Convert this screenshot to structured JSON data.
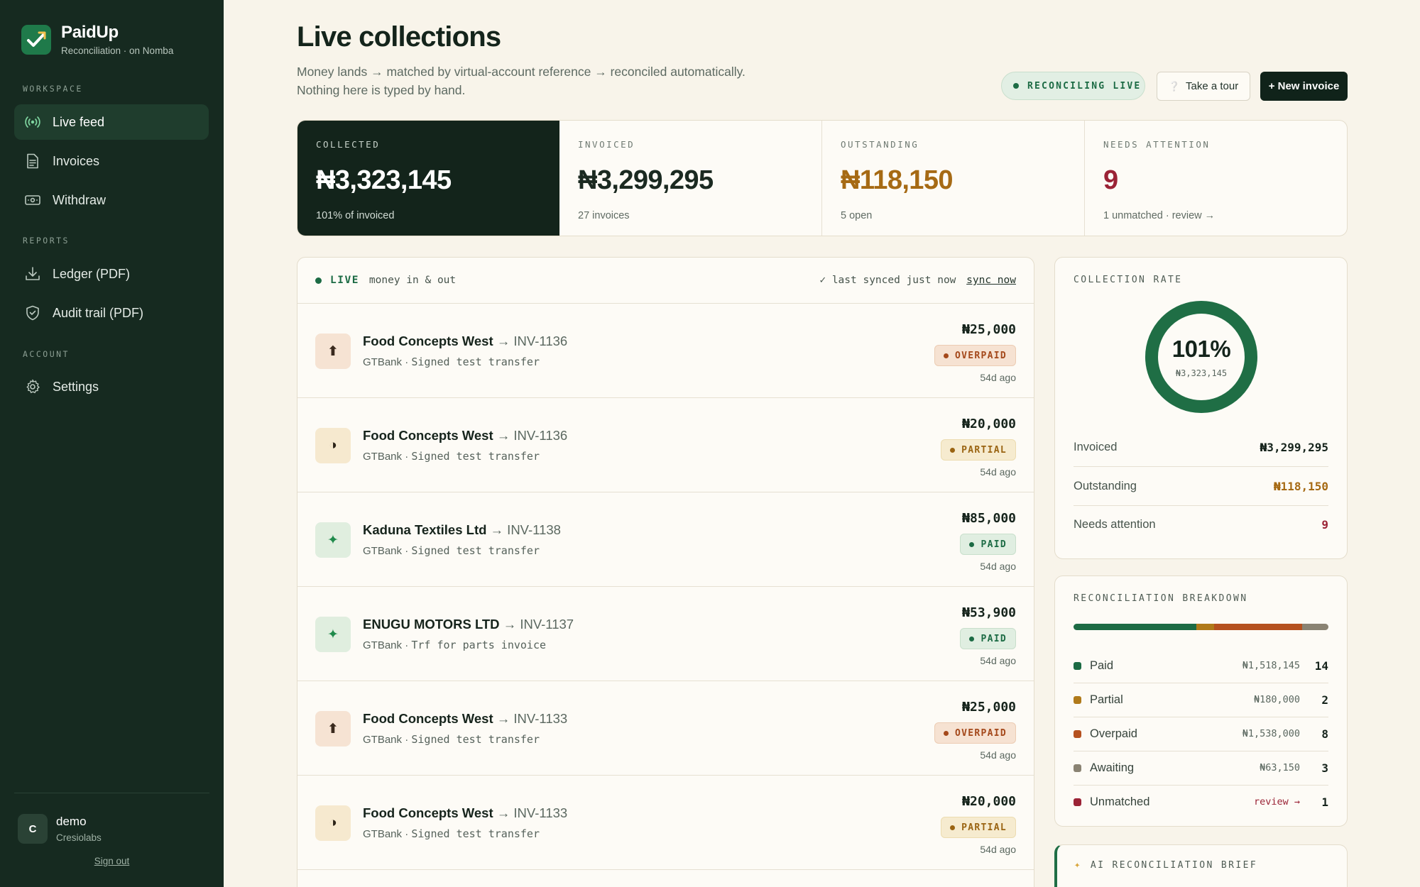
{
  "brand": {
    "name": "PaidUp",
    "subtitle": "Reconciliation · on Nomba"
  },
  "sidebar": {
    "sections": {
      "workspace": "WORKSPACE",
      "reports": "REPORTS",
      "account": "ACCOUNT"
    },
    "items": [
      {
        "label": "Live feed",
        "icon": "broadcast-icon",
        "active": true
      },
      {
        "label": "Invoices",
        "icon": "document-icon"
      },
      {
        "label": "Withdraw",
        "icon": "cash-icon"
      },
      {
        "label": "Ledger (PDF)",
        "icon": "download-icon"
      },
      {
        "label": "Audit trail (PDF)",
        "icon": "shield-icon"
      },
      {
        "label": "Settings",
        "icon": "gear-icon"
      }
    ],
    "user": {
      "initial": "C",
      "name": "demo",
      "org": "Cresiolabs"
    },
    "signout": "Sign out"
  },
  "header": {
    "title": "Live collections",
    "subtitle_line1": "Money lands → matched by virtual-account reference → reconciled automatically.",
    "subtitle_line2": "Nothing here is typed by hand.",
    "status_pill": "RECONCILING LIVE",
    "tour_button": "Take a tour",
    "new_button": "+ New invoice"
  },
  "stats": [
    {
      "label": "COLLECTED",
      "value": "₦3,323,145",
      "note": "101% of invoiced"
    },
    {
      "label": "INVOICED",
      "value": "₦3,299,295",
      "note": "27 invoices"
    },
    {
      "label": "OUTSTANDING",
      "value": "₦118,150",
      "note": "5 open"
    },
    {
      "label": "NEEDS ATTENTION",
      "value": "9",
      "note": "1 unmatched · review →"
    }
  ],
  "feed": {
    "live_label": "LIVE",
    "title": "money in & out",
    "sync_text": "✓ last synced just now",
    "sync_link": "sync now",
    "rows": [
      {
        "customer": "Food Concepts West",
        "invoice": " → INV-1136",
        "bank": "GTBank",
        "memo": "Signed test transfer",
        "amount": "₦25,000",
        "status": "OVERPAID",
        "time": "54d ago",
        "glyph": "⬆"
      },
      {
        "customer": "Food Concepts West",
        "invoice": " → INV-1136",
        "bank": "GTBank",
        "memo": "Signed test transfer",
        "amount": "₦20,000",
        "status": "PARTIAL",
        "time": "54d ago",
        "glyph": "◑"
      },
      {
        "customer": "Kaduna Textiles Ltd",
        "invoice": " → INV-1138",
        "bank": "GTBank",
        "memo": "Signed test transfer",
        "amount": "₦85,000",
        "status": "PAID",
        "time": "54d ago",
        "glyph": "✦"
      },
      {
        "customer": "ENUGU MOTORS LTD",
        "invoice": " → INV-1137",
        "bank": "GTBank",
        "memo": "Trf for parts invoice",
        "amount": "₦53,900",
        "status": "PAID",
        "time": "54d ago",
        "glyph": "✦"
      },
      {
        "customer": "Food Concepts West",
        "invoice": " → INV-1133",
        "bank": "GTBank",
        "memo": "Signed test transfer",
        "amount": "₦25,000",
        "status": "OVERPAID",
        "time": "54d ago",
        "glyph": "⬆"
      },
      {
        "customer": "Food Concepts West",
        "invoice": " → INV-1133",
        "bank": "GTBank",
        "memo": "Signed test transfer",
        "amount": "₦20,000",
        "status": "PARTIAL",
        "time": "54d ago",
        "glyph": "◑"
      }
    ]
  },
  "collection_rate": {
    "label": "COLLECTION RATE",
    "percent": "101%",
    "fraction": 1.0,
    "amount": "₦3,323,145",
    "rows": [
      {
        "label": "Invoiced",
        "value": "₦3,299,295"
      },
      {
        "label": "Outstanding",
        "value": "₦118,150"
      },
      {
        "label": "Needs attention",
        "value": "9"
      }
    ]
  },
  "breakdown": {
    "label": "RECONCILIATION BREAKDOWN",
    "items": [
      {
        "label": "Paid",
        "amount": "₦1,518,145",
        "count": "14",
        "color": "#1c6b44"
      },
      {
        "label": "Partial",
        "amount": "₦180,000",
        "count": "2",
        "color": "#b07a1a"
      },
      {
        "label": "Overpaid",
        "amount": "₦1,538,000",
        "count": "8",
        "color": "#b5511f"
      },
      {
        "label": "Awaiting",
        "amount": "₦63,150",
        "count": "3",
        "color": "#8a8373"
      },
      {
        "label": "Unmatched",
        "amount": "review →",
        "count": "1",
        "color": "#9b2336"
      }
    ],
    "bar_fractions": [
      0.52,
      0.075,
      0.375,
      0.11
    ]
  },
  "brief": {
    "label": "AI RECONCILIATION BRIEF",
    "icon": "sparkle-icon"
  },
  "colors": {
    "accent": "#1c6b44",
    "dark": "#13241b",
    "warning": "#a66a14",
    "danger": "#9b2336"
  }
}
